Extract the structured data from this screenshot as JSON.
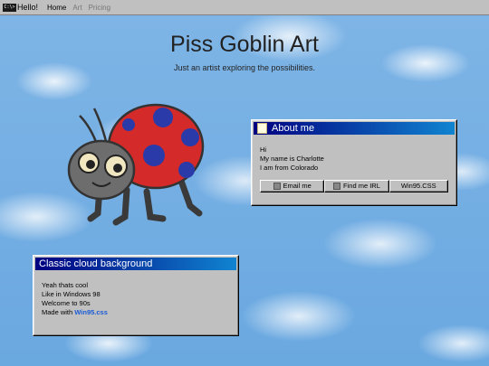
{
  "nav": {
    "brand": "Hello!",
    "brand_icon_text": "C:\\>",
    "links": [
      {
        "label": "Home",
        "active": true
      },
      {
        "label": "Art",
        "active": false
      },
      {
        "label": "Pricing",
        "active": false
      }
    ]
  },
  "hero": {
    "title": "Piss Goblin Art",
    "subtitle": "Just an artist exploring the possibilities."
  },
  "about_window": {
    "title": "About me",
    "lines": [
      "Hi",
      "My name is Charlotte",
      "I am from Colorado"
    ],
    "buttons": [
      "Email me",
      "Find me IRL",
      "Win95.CSS"
    ]
  },
  "cloud_window": {
    "title": "Classic cloud background",
    "lines": [
      "Yeah thats cool",
      "Like in Windows 98",
      "Welcome to 90s"
    ],
    "made_with_prefix": "Made with ",
    "made_with_link": "Win95.css"
  },
  "colors": {
    "titlebar_start": "#000080",
    "titlebar_end": "#1084d0",
    "window_face": "#c0c0c0",
    "sky": "#7fb5e6",
    "link": "#1a5bd6"
  }
}
